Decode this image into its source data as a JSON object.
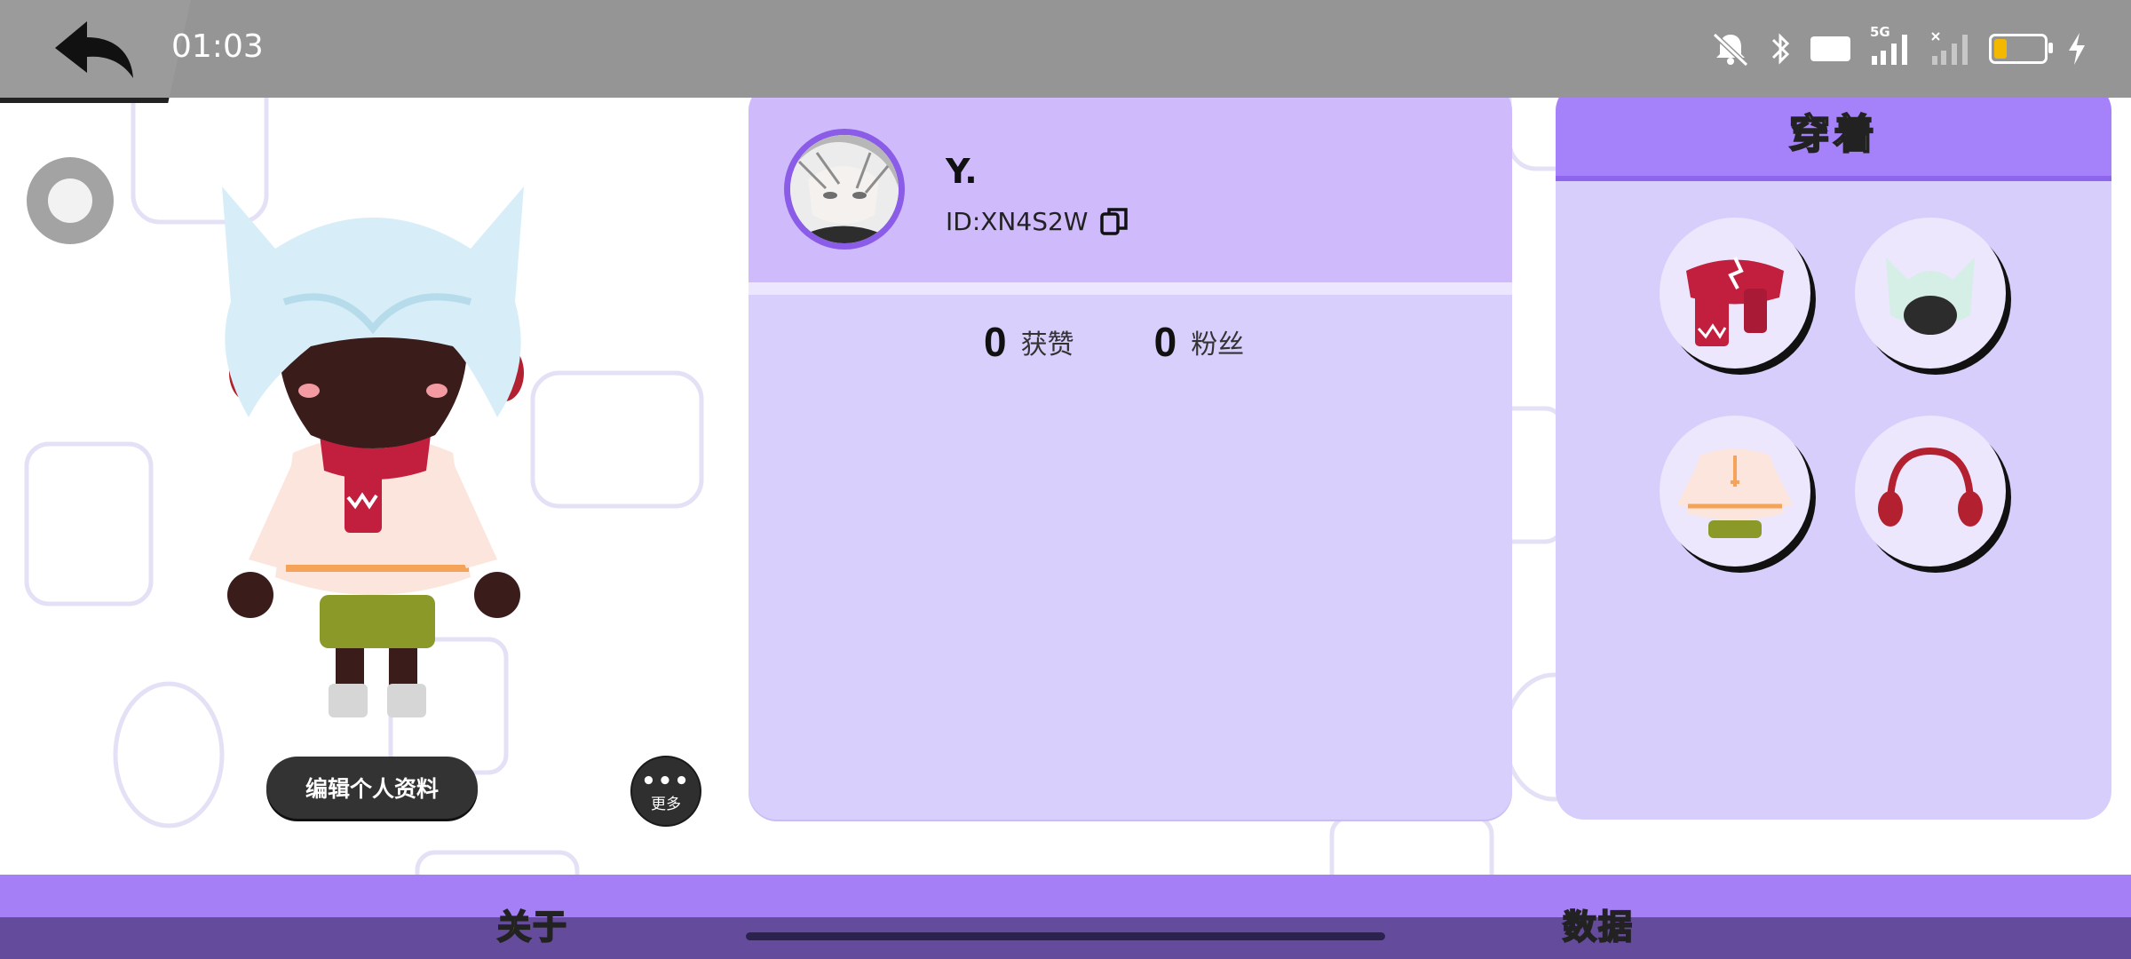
{
  "status_bar": {
    "time": "01:03",
    "hd_label": "HD",
    "network_label": "5G",
    "battery_level": 0.25,
    "icons": [
      "mute-icon",
      "bluetooth-icon",
      "hd-icon",
      "signal-5g-icon",
      "signal-no-sim-icon",
      "battery-icon",
      "charging-icon"
    ]
  },
  "left": {
    "edit_profile_label": "编辑个人资料",
    "more_dots": "•••",
    "more_label": "更多"
  },
  "profile": {
    "name": "Y.",
    "id_text": "ID:XN4S2W",
    "stats": [
      {
        "value": "0",
        "label": "获赞"
      },
      {
        "value": "0",
        "label": "粉丝"
      }
    ]
  },
  "wearing": {
    "title": "穿着",
    "items": [
      "scarf",
      "hair",
      "sweater-outfit",
      "earmuffs"
    ]
  },
  "tabs": {
    "about": "关于",
    "data": "数据"
  },
  "colors": {
    "status_bar": "#959595",
    "card_bg": "#d8cffc",
    "card_header": "#cfbbfb",
    "wear_header": "#a582fa",
    "tab_active": "#ffd23d",
    "bottom_bar": "#a47ff5"
  }
}
